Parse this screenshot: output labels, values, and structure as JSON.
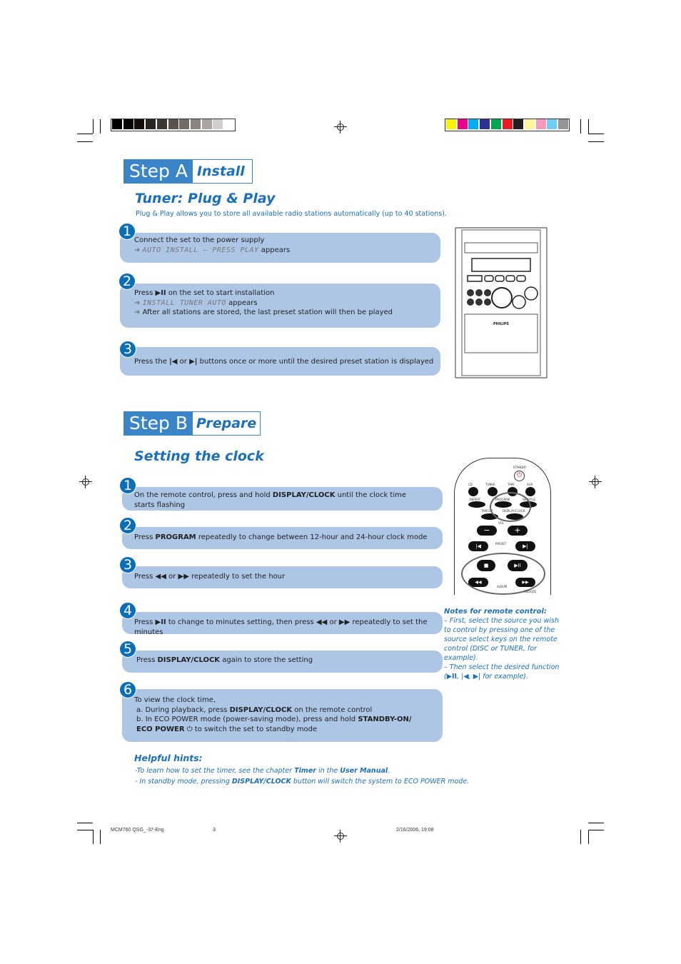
{
  "print_marks": {
    "gray_bar": [
      "#000000",
      "#070505",
      "#150d0a",
      "#2a2523",
      "#3e3835",
      "#5a514e",
      "#726a67",
      "#8b8481",
      "#aaa5a2",
      "#d2cece",
      "#ffffff"
    ],
    "color_bar": [
      "#fff200",
      "#ec008c",
      "#00aeef",
      "#2e3192",
      "#00a651",
      "#ed1c24",
      "#231f20",
      "#fff799",
      "#f49ac1",
      "#6dcff6",
      "#939598"
    ]
  },
  "step_a": {
    "label": "Step A",
    "name": "Install",
    "title": "Tuner: Plug & Play",
    "intro": "Plug & Play allows you to store all available radio stations automatically (up to 40 stations).",
    "steps": [
      {
        "num": "1",
        "line1": "Connect the set to the power supply",
        "lcd": "AUTO INSTALL – PRESS PLAY",
        "appears": "appears"
      },
      {
        "num": "2",
        "press": "Press",
        "after_icon": "on the set to start installation",
        "lcd": "INSTALL TUNER AUTO",
        "appears": "appears",
        "line3": "After all stations are stored, the last preset station will then be played"
      },
      {
        "num": "3",
        "press": "Press the",
        "or": "or",
        "rest": "buttons once or more until the desired preset station is displayed"
      }
    ],
    "device_brand": "PHILIPS"
  },
  "step_b": {
    "label": "Step B",
    "name": "Prepare",
    "title": "Setting the clock",
    "steps": [
      {
        "num": "1",
        "t1": "On the remote control, press and hold ",
        "b1": "DISPLAY/CLOCK",
        "t2": " until the clock time starts flashing"
      },
      {
        "num": "2",
        "t1": "Press ",
        "b1": "PROGRAM",
        "t2": " repeatedly to change between 12-hour and 24-hour clock mode"
      },
      {
        "num": "3",
        "t1": "Press",
        "or": "or",
        "t2": "repeatedly to set the hour"
      },
      {
        "num": "4",
        "t1": "Press",
        "t2": "to change to minutes setting, then press",
        "or": "or",
        "t3": "repeatedly to set the  minutes"
      },
      {
        "num": "5",
        "t1": "Press ",
        "b1": "DISPLAY/CLOCK",
        "t2": " again to store the setting"
      },
      {
        "num": "6",
        "t1": "To view the clock time,",
        "a1": "a.  During playback, press ",
        "a_b": "DISPLAY/CLOCK",
        "a2": " on the remote control",
        "b1": "b.  In ECO POWER mode (power-saving mode), press and hold ",
        "b_b": "STANDBY-ON/ ECO POWER",
        "b2": " to switch the set to standby mode"
      }
    ],
    "remote_labels": {
      "standby": "STANDBY",
      "cd": "CD",
      "tuner": "TUNER",
      "tape": "TAPE",
      "aux": "AUX",
      "repeat": "REPEAT",
      "program": "PROGRAM",
      "shuffle": "SHUFFLE",
      "tape12": "TAPE1/2",
      "display": "DISPLAY/CLOCK",
      "vol": "VOL",
      "preset": "PRESET",
      "album": "ALBUM",
      "snooze": "SNOOZE"
    },
    "notes": {
      "title": "Notes for remote control:",
      "n1": "–   First, select the source you wish to control by pressing one of the source select keys on the remote control (DISC or TUNER, for example).",
      "n2a": "–   Then select the desired function (",
      "n2b": " for example)."
    },
    "hints": {
      "title": "Helpful hints:",
      "h1a": "-To learn how to set the timer, see the chapter ",
      "h1b": "Timer",
      "h1c": " in the ",
      "h1d": "User Manual",
      ".": ".",
      "h1e": ".",
      "h2a": "- In standby mode, pressing ",
      "h2b": "DISPLAY/CLOCK",
      "h2c": " button will switch the system to ECO POWER mode."
    }
  },
  "footer": {
    "file": "MCM760 QSG_-37-Eng",
    "page": "3",
    "date": "2/16/2006, 19:08"
  }
}
